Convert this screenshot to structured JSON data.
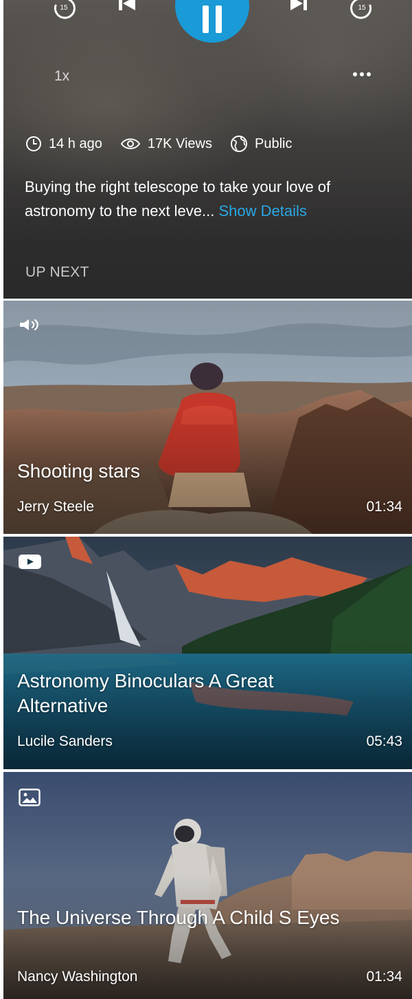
{
  "player": {
    "rewind_seconds": "15",
    "forward_seconds": "15",
    "speed_label": "1x",
    "time_ago": "14 h ago",
    "views": "17K Views",
    "visibility": "Public",
    "description": "Buying the right telescope to take your love of astronomy to the next leve...",
    "show_details_label": "Show Details",
    "up_next_label": "UP NEXT",
    "accent_color": "#1a9ad6",
    "link_color": "#28a8e6"
  },
  "up_next": [
    {
      "media_type_icon": "speaker-icon",
      "title": "Shooting stars",
      "author": "Jerry Steele",
      "duration": "01:34"
    },
    {
      "media_type_icon": "video-icon",
      "title": "Astronomy Binoculars A Great Alternative",
      "author": "Lucile Sanders",
      "duration": "05:43"
    },
    {
      "media_type_icon": "image-icon",
      "title": "The Universe Through A Child S Eyes",
      "author": "Nancy Washington",
      "duration": "01:34"
    }
  ]
}
